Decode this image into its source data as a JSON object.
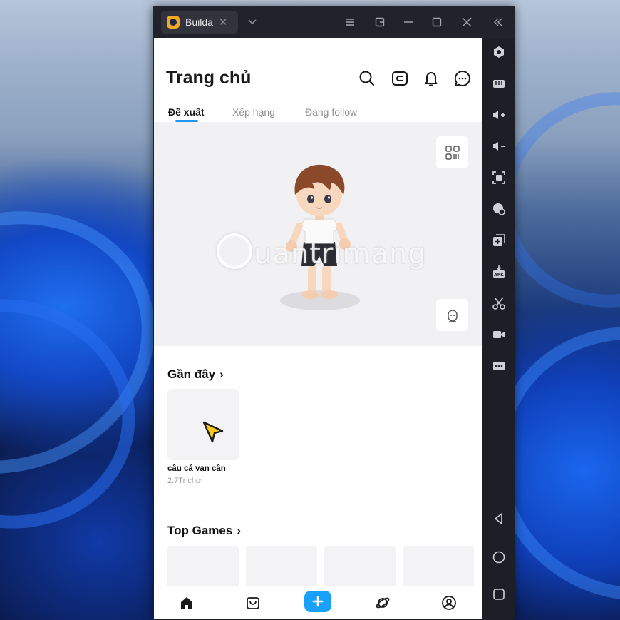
{
  "window": {
    "tab_title": "Builda",
    "tab_close": "✕",
    "tab_dropdown": "⌄"
  },
  "app": {
    "page_title": "Trang chủ",
    "tabs": [
      {
        "label": "Đề xuất",
        "active": true
      },
      {
        "label": "Xếp hạng",
        "active": false
      },
      {
        "label": "Đang follow",
        "active": false
      }
    ],
    "header_icons": [
      "search-icon",
      "wallet-icon",
      "bell-icon",
      "chat-icon"
    ],
    "hero": {
      "watermark": "uantrimang",
      "buttons": [
        "qr-code-icon",
        "face-icon"
      ]
    },
    "recent": {
      "title": "Gần đây",
      "chevron": "›",
      "items": [
        {
          "name": "câu cá vạn cân",
          "plays": "2.7Tr chơi"
        }
      ]
    },
    "top_games": {
      "title": "Top Games",
      "chevron": "›"
    },
    "bottom_nav": [
      "home-icon",
      "bag-icon",
      "plus-icon",
      "planet-icon",
      "profile-icon"
    ],
    "accent_color": "#18a0fb"
  },
  "rail": {
    "tools": [
      "gamepad-icon",
      "keyboard-icon",
      "volume-up-icon",
      "volume-down-icon",
      "screenshot-icon",
      "screen-record-icon",
      "multi-instance-icon",
      "apk-icon",
      "scissors-icon",
      "video-icon",
      "more-icon",
      "back-icon",
      "home-icon",
      "recents-icon"
    ]
  }
}
